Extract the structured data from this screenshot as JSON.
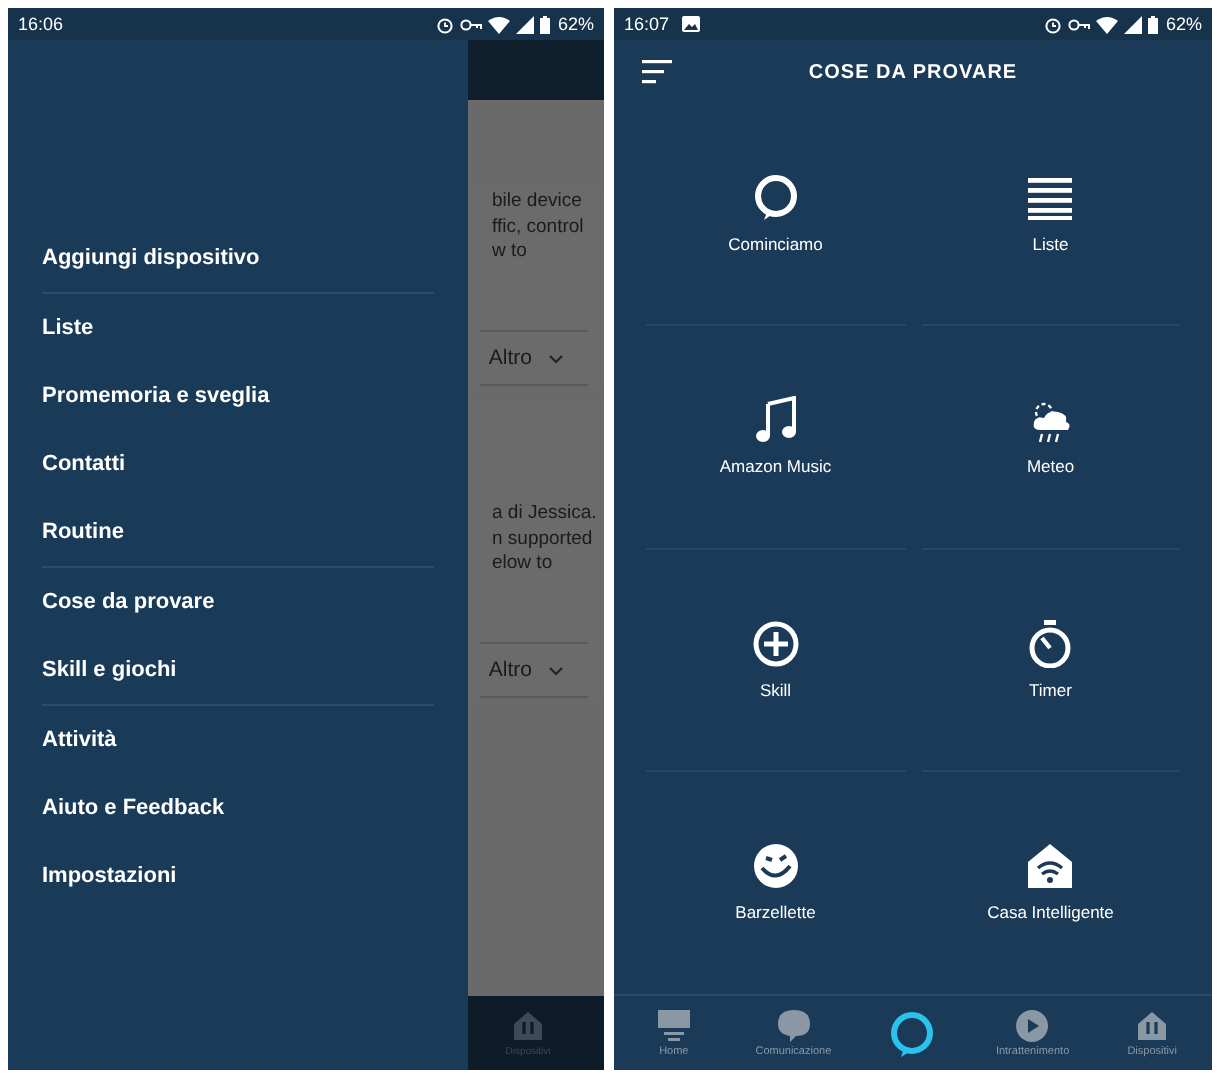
{
  "left_screen": {
    "status_bar": {
      "time": "16:06",
      "battery": "62%"
    },
    "background": {
      "card_texts": [
        {
          "lines": [
            "bile device",
            "ffic, control",
            "w to"
          ],
          "action": "Altro"
        },
        {
          "lines": [
            "a di Jessica.",
            "n supported",
            "elow to"
          ],
          "action": "Altro"
        }
      ],
      "bottom_nav_label": "Dispositivi"
    },
    "drawer": {
      "items": [
        {
          "label": "Aggiungi dispositivo",
          "divider_after": true
        },
        {
          "label": "Liste",
          "divider_after": false
        },
        {
          "label": "Promemoria e sveglia",
          "divider_after": false
        },
        {
          "label": "Contatti",
          "divider_after": false
        },
        {
          "label": "Routine",
          "divider_after": true
        },
        {
          "label": "Cose da provare",
          "divider_after": false
        },
        {
          "label": "Skill e giochi",
          "divider_after": true
        },
        {
          "label": "Attività",
          "divider_after": false
        },
        {
          "label": "Aiuto e Feedback",
          "divider_after": false
        },
        {
          "label": "Impostazioni",
          "divider_after": false
        }
      ]
    }
  },
  "right_screen": {
    "status_bar": {
      "time": "16:07",
      "battery": "62%"
    },
    "title": "COSE DA PROVARE",
    "tiles": [
      {
        "label": "Cominciamo"
      },
      {
        "label": "Liste"
      },
      {
        "label": "Amazon Music"
      },
      {
        "label": "Meteo"
      },
      {
        "label": "Skill"
      },
      {
        "label": "Timer"
      },
      {
        "label": "Barzellette"
      },
      {
        "label": "Casa Intelligente"
      }
    ],
    "bottom_nav": [
      {
        "label": "Home",
        "kind": "tab"
      },
      {
        "label": "Comunicazione",
        "kind": "tab"
      },
      {
        "kind": "alexa"
      },
      {
        "label": "Intrattenimento",
        "kind": "tab"
      },
      {
        "label": "Dispositivi",
        "kind": "tab"
      }
    ]
  }
}
